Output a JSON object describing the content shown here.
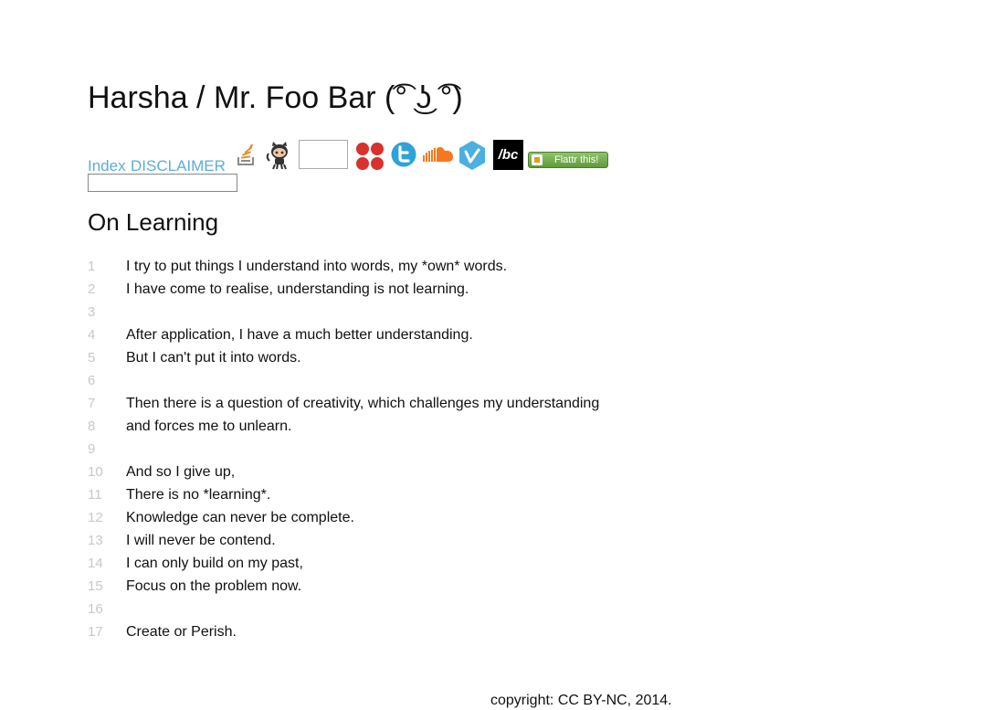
{
  "header": {
    "title": "Harsha / Mr. Foo Bar (͡° ͜ʖ ͡°)"
  },
  "nav": {
    "links": [
      {
        "label": "Index"
      },
      {
        "label": "DISCLAIMER"
      }
    ],
    "icons": [
      "stackoverflow-icon",
      "github-octocat-icon",
      "blank-badge-icon",
      "red-dots-icon",
      "twitter-icon",
      "soundcloud-icon",
      "vimeo-icon",
      "bandcamp-icon"
    ],
    "bandcamp_text": "/bc",
    "flattr_label": "Flattr this!",
    "search": {
      "value": "",
      "placeholder": ""
    }
  },
  "article": {
    "heading": "On Learning",
    "lines": [
      {
        "num": "1",
        "text": "I try to put things I understand into words, my *own* words."
      },
      {
        "num": "2",
        "text": "I have come to realise, understanding is not learning."
      },
      {
        "num": "3",
        "text": ""
      },
      {
        "num": "4",
        "text": "After application, I have a much better understanding."
      },
      {
        "num": "5",
        "text": "But I can't put it into words."
      },
      {
        "num": "6",
        "text": ""
      },
      {
        "num": "7",
        "text": "Then there is a question of creativity, which challenges my understanding"
      },
      {
        "num": "8",
        "text": "and forces me to unlearn."
      },
      {
        "num": "9",
        "text": ""
      },
      {
        "num": "10",
        "text": "And so I give up,"
      },
      {
        "num": "11",
        "text": "There is no *learning*."
      },
      {
        "num": "12",
        "text": "Knowledge can never be complete."
      },
      {
        "num": "13",
        "text": "I will never be contend."
      },
      {
        "num": "14",
        "text": "I can only build on my past,"
      },
      {
        "num": "15",
        "text": "Focus on the problem now."
      },
      {
        "num": "16",
        "text": ""
      },
      {
        "num": "17",
        "text": "Create or Perish."
      }
    ]
  },
  "footer": {
    "copyright": "copyright: CC BY-NC, 2014."
  },
  "colors": {
    "link": "#5aaed8",
    "line_number": "#c8c8c8",
    "twitter": "#2ea3d8",
    "soundcloud": "#f7781f",
    "vimeo": "#4bb0e0",
    "dots": "#d8312e",
    "flattr": "#6aa844"
  }
}
